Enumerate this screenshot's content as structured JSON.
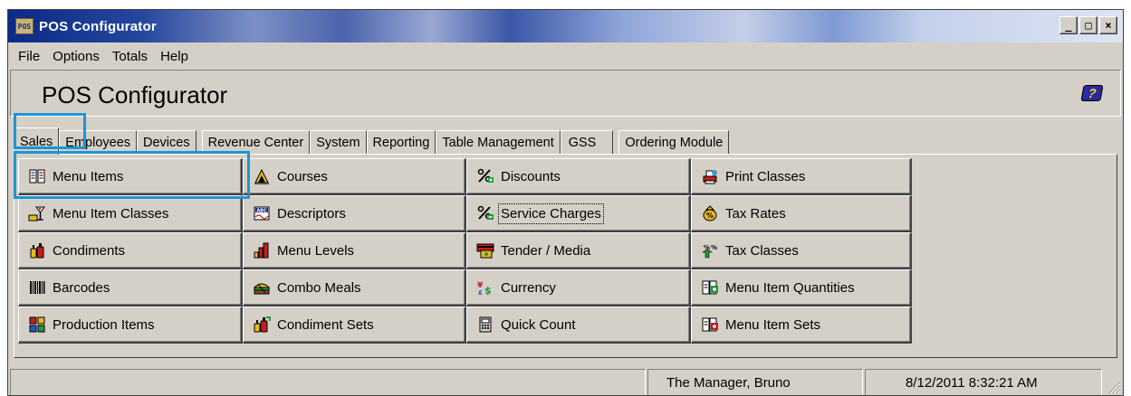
{
  "window": {
    "title": "POS Configurator",
    "app_icon_text": "POS",
    "controls": {
      "minimize": "_",
      "maximize": "□",
      "close": "×"
    }
  },
  "menubar": [
    "File",
    "Options",
    "Totals",
    "Help"
  ],
  "header": {
    "app_title": "POS Configurator",
    "help_icon": "help-book-icon"
  },
  "tabs": [
    {
      "label": "Sales",
      "active": true
    },
    {
      "label": "Employees",
      "active": false
    },
    {
      "label": "Devices",
      "active": false
    },
    {
      "label": "Revenue Center",
      "active": false
    },
    {
      "label": "System",
      "active": false
    },
    {
      "label": "Reporting",
      "active": false
    },
    {
      "label": "Table Management",
      "active": false
    },
    {
      "label": "GSS",
      "active": false
    },
    {
      "label": "Ordering Module",
      "active": false
    }
  ],
  "sales_buttons": [
    [
      {
        "label": "Menu Items",
        "icon": "menu-items-icon"
      },
      {
        "label": "Courses",
        "icon": "courses-icon"
      },
      {
        "label": "Discounts",
        "icon": "discounts-icon"
      },
      {
        "label": "Print Classes",
        "icon": "print-classes-icon"
      }
    ],
    [
      {
        "label": "Menu Item Classes",
        "icon": "menu-item-classes-icon"
      },
      {
        "label": "Descriptors",
        "icon": "descriptors-icon"
      },
      {
        "label": "Service Charges",
        "icon": "service-charges-icon"
      },
      {
        "label": "Tax Rates",
        "icon": "tax-rates-icon"
      }
    ],
    [
      {
        "label": "Condiments",
        "icon": "condiments-icon"
      },
      {
        "label": "Menu Levels",
        "icon": "menu-levels-icon"
      },
      {
        "label": "Tender / Media",
        "icon": "tender-media-icon"
      },
      {
        "label": "Tax Classes",
        "icon": "tax-classes-icon"
      }
    ],
    [
      {
        "label": "Barcodes",
        "icon": "barcodes-icon"
      },
      {
        "label": "Combo Meals",
        "icon": "combo-meals-icon"
      },
      {
        "label": "Currency",
        "icon": "currency-icon"
      },
      {
        "label": "Menu Item Quantities",
        "icon": "menu-item-quantities-icon"
      }
    ],
    [
      {
        "label": "Production Items",
        "icon": "production-items-icon"
      },
      {
        "label": "Condiment Sets",
        "icon": "condiment-sets-icon"
      },
      {
        "label": "Quick Count",
        "icon": "quick-count-icon"
      },
      {
        "label": "Menu Item Sets",
        "icon": "menu-item-sets-icon"
      }
    ]
  ],
  "focused_button": "Service Charges",
  "highlights": {
    "color": "#1f95d4"
  },
  "statusbar": {
    "message": "",
    "user": "The Manager, Bruno",
    "datetime": "8/12/2011 8:32:21 AM"
  }
}
